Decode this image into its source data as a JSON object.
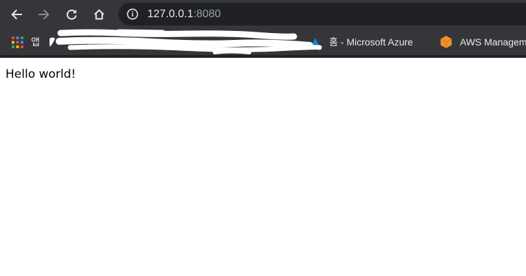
{
  "toolbar": {
    "back_icon": "arrow-left-icon",
    "forward_icon": "arrow-right-icon",
    "reload_icon": "reload-icon",
    "home_icon": "home-icon"
  },
  "address_bar": {
    "host": "127.0.0.1",
    "port": ":8080",
    "icon": "info-icon"
  },
  "bookmarks": {
    "apps_label": "앱",
    "items": [
      {
        "label": "홈 - Microsoft Azure",
        "icon": "azure-icon"
      },
      {
        "label": "AWS Management Console",
        "icon": "aws-icon"
      }
    ]
  },
  "page": {
    "text": "Hello world!"
  },
  "colors": {
    "toolbar_bg": "#35363a",
    "omnibox_bg": "#202124",
    "text_light": "#e8eaed",
    "text_dim": "#9aa0a6",
    "aws_orange": "#f0932b",
    "azure_blue": "#0a84d6"
  }
}
